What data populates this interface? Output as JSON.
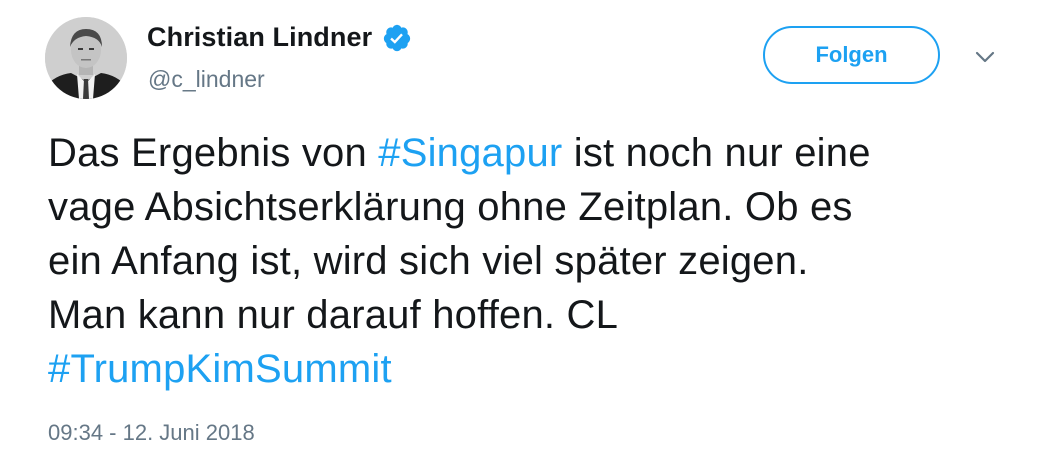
{
  "author": {
    "name": "Christian Lindner",
    "handle": "@c_lindner",
    "verified": true
  },
  "follow_button": {
    "label": "Folgen"
  },
  "tweet": {
    "line1_pre": "Das Ergebnis von ",
    "hashtag1": "#Singapur",
    "line1_post": " ist noch nur eine",
    "line2": "vage Absichtserklärung ohne Zeitplan. Ob es",
    "line3": "ein Anfang ist, wird sich viel später zeigen.",
    "line4": "Man kann nur darauf hoffen. CL",
    "hashtag2": "#TrumpKimSummit"
  },
  "timestamp": "09:34 - 12. Juni 2018",
  "colors": {
    "accent": "#1da1f2",
    "text": "#14171a",
    "muted": "#657786"
  },
  "icons": {
    "verified": "verified-badge-icon",
    "menu": "chevron-down-icon"
  }
}
